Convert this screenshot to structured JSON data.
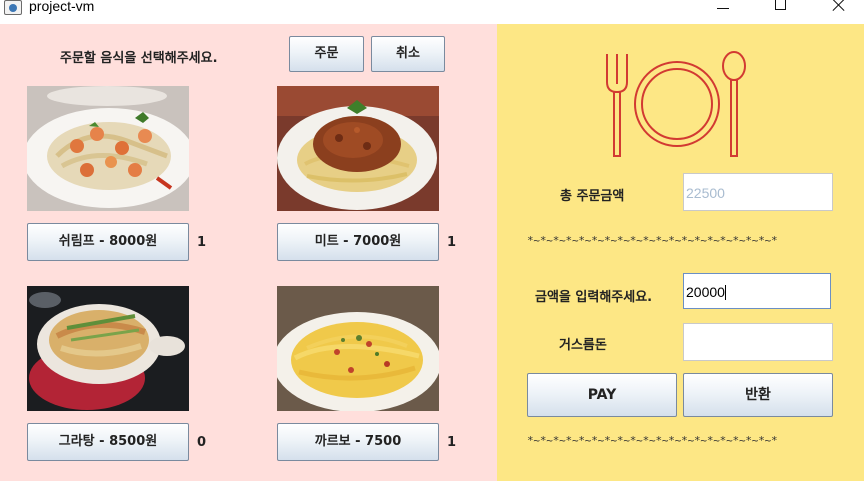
{
  "window": {
    "title": "project-vm"
  },
  "menu": {
    "prompt": "주문할 음식을 선택해주세요.",
    "order_button": "주문",
    "cancel_button": "취소",
    "items": [
      {
        "label": "쉬림프 - 8000원",
        "count": "1",
        "icon": "shrimp-pasta-image"
      },
      {
        "label": "미트 - 7000원",
        "count": "1",
        "icon": "meat-pasta-image"
      },
      {
        "label": "그라탕 - 8500원",
        "count": "0",
        "icon": "gratin-image"
      },
      {
        "label": "까르보 - 7500",
        "count": "1",
        "icon": "carbonara-image"
      }
    ]
  },
  "payment": {
    "total_label": "총 주문금액",
    "total_value": "22500",
    "divider": "*~*~*~*~*~*~*~*~*~*~*~*~*~*~*~*~*~*~*~*",
    "amount_label": "금액을 입력해주세요.",
    "amount_value": "20000",
    "change_label": "거스름돈",
    "change_value": "",
    "pay_button": "PAY",
    "return_button": "반환"
  },
  "colors": {
    "left_panel": "#ffdfdc",
    "right_panel": "#fde785",
    "cutlery": "#d23a32"
  }
}
